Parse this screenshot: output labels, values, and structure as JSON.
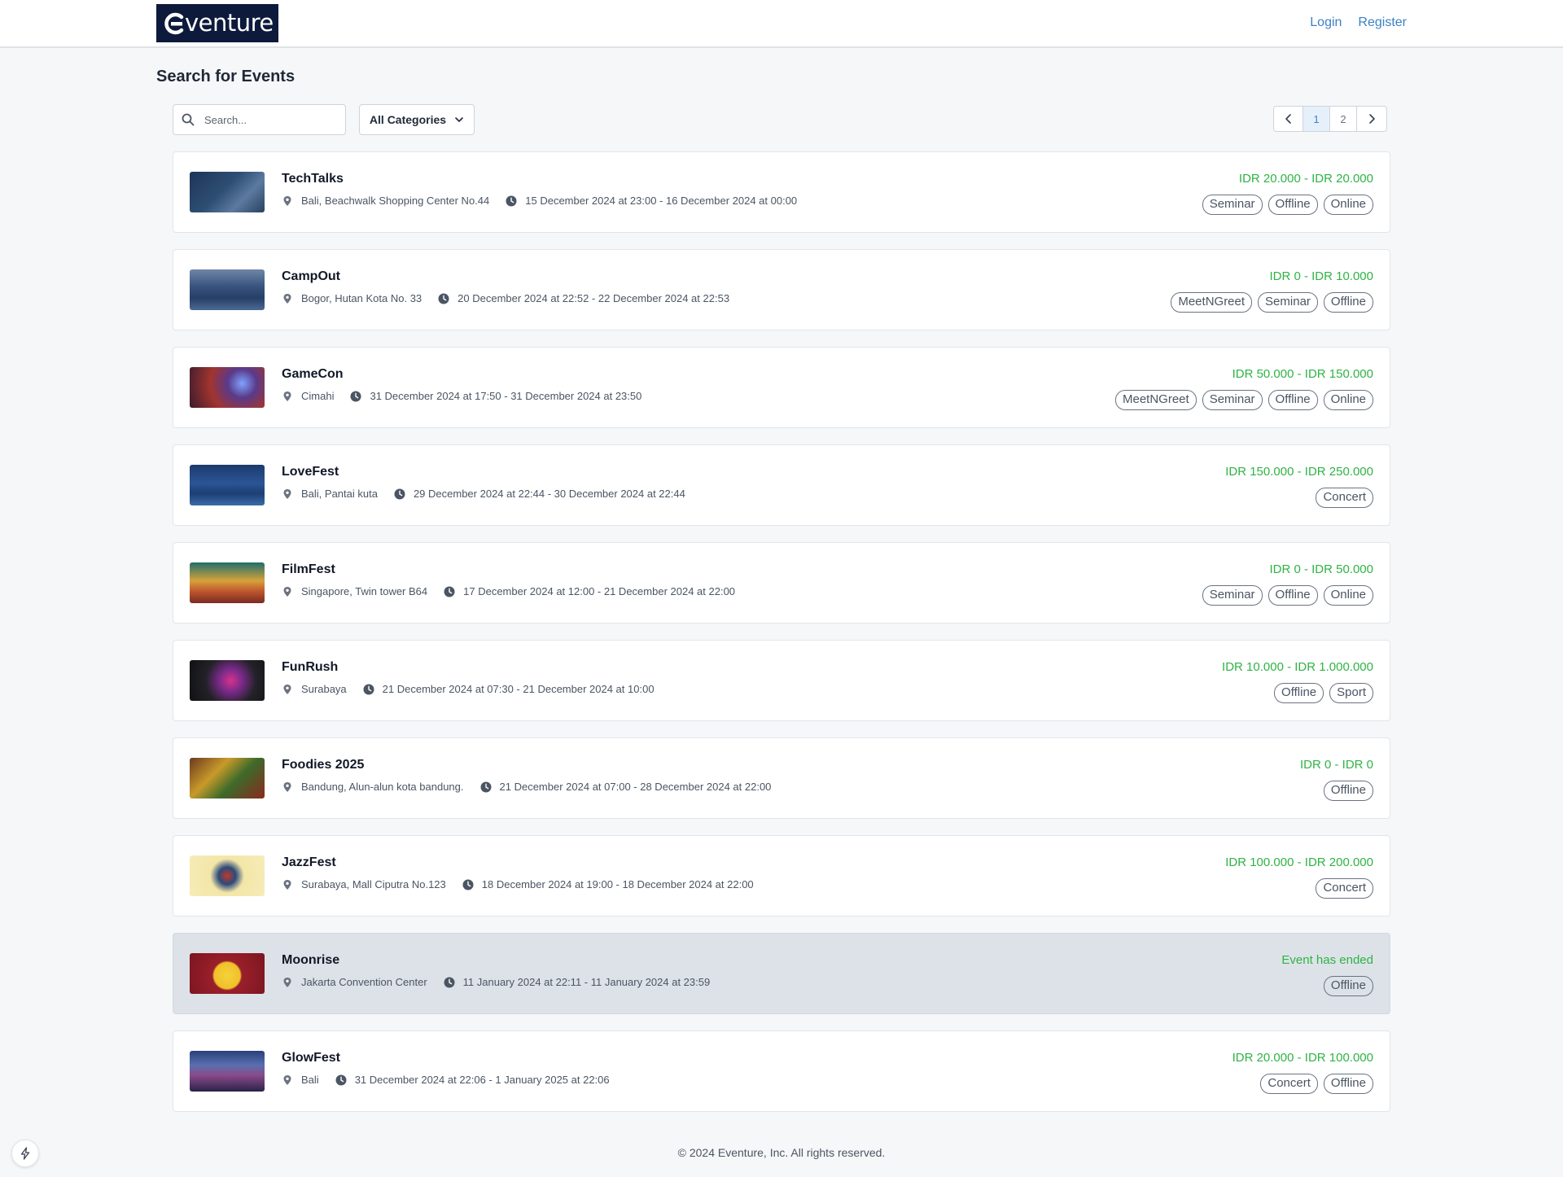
{
  "brand": {
    "logo_text": "venture",
    "logo_bg": "#0d1a3c"
  },
  "nav": {
    "login": "Login",
    "register": "Register",
    "link_color": "#3b82c4"
  },
  "page": {
    "title": "Search for Events"
  },
  "search": {
    "placeholder": "Search...",
    "value": ""
  },
  "filter": {
    "selected": "All Categories"
  },
  "pagination": {
    "pages": [
      "1",
      "2"
    ],
    "current": "1"
  },
  "colors": {
    "price": "#2fb344",
    "ended_card_bg": "#dde2e8"
  },
  "events": [
    {
      "name": "TechTalks",
      "location": "Bali, Beachwalk Shopping Center No.44",
      "time": "15 December 2024 at 23:00 - 16 December 2024 at 00:00",
      "price": "IDR 20.000 - IDR 20.000",
      "tags": [
        "Seminar",
        "Offline",
        "Online"
      ],
      "ended": false
    },
    {
      "name": "CampOut",
      "location": "Bogor, Hutan Kota No. 33",
      "time": "20 December 2024 at 22:52 - 22 December 2024 at 22:53",
      "price": "IDR 0 - IDR 10.000",
      "tags": [
        "MeetNGreet",
        "Seminar",
        "Offline"
      ],
      "ended": false
    },
    {
      "name": "GameCon",
      "location": "Cimahi",
      "time": "31 December 2024 at 17:50 - 31 December 2024 at 23:50",
      "price": "IDR 50.000 - IDR 150.000",
      "tags": [
        "MeetNGreet",
        "Seminar",
        "Offline",
        "Online"
      ],
      "ended": false
    },
    {
      "name": "LoveFest",
      "location": "Bali, Pantai kuta",
      "time": "29 December 2024 at 22:44 - 30 December 2024 at 22:44",
      "price": "IDR 150.000 - IDR 250.000",
      "tags": [
        "Concert"
      ],
      "ended": false
    },
    {
      "name": "FilmFest",
      "location": "Singapore, Twin tower B64",
      "time": "17 December 2024 at 12:00 - 21 December 2024 at 22:00",
      "price": "IDR 0 - IDR 50.000",
      "tags": [
        "Seminar",
        "Offline",
        "Online"
      ],
      "ended": false
    },
    {
      "name": "FunRush",
      "location": "Surabaya",
      "time": "21 December 2024 at 07:30 - 21 December 2024 at 10:00",
      "price": "IDR 10.000 - IDR 1.000.000",
      "tags": [
        "Offline",
        "Sport"
      ],
      "ended": false
    },
    {
      "name": "Foodies 2025",
      "location": "Bandung, Alun-alun kota bandung.",
      "time": "21 December 2024 at 07:00 - 28 December 2024 at 22:00",
      "price": "IDR 0 - IDR 0",
      "tags": [
        "Offline"
      ],
      "ended": false
    },
    {
      "name": "JazzFest",
      "location": "Surabaya, Mall Ciputra No.123",
      "time": "18 December 2024 at 19:00 - 18 December 2024 at 22:00",
      "price": "IDR 100.000 - IDR 200.000",
      "tags": [
        "Concert"
      ],
      "ended": false
    },
    {
      "name": "Moonrise",
      "location": "Jakarta Convention Center",
      "time": "11 January 2024 at 22:11 - 11 January 2024 at 23:59",
      "price": "Event has ended",
      "tags": [
        "Offline"
      ],
      "ended": true
    },
    {
      "name": "GlowFest",
      "location": "Bali",
      "time": "31 December 2024 at 22:06 - 1 January 2025 at 22:06",
      "price": "IDR 20.000 - IDR 100.000",
      "tags": [
        "Concert",
        "Offline"
      ],
      "ended": false
    }
  ],
  "footer": {
    "copyright": "© 2024 Eventure, Inc. All rights reserved."
  }
}
